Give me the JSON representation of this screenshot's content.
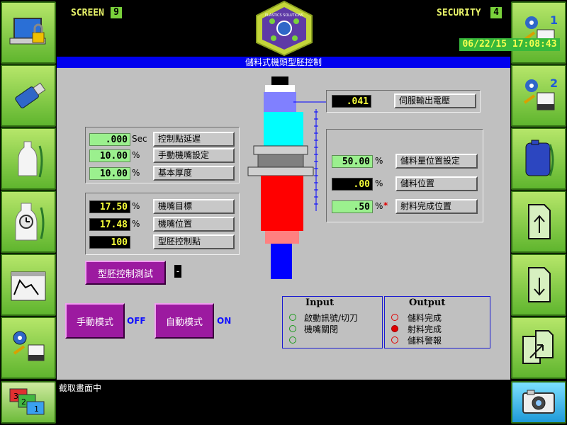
{
  "header": {
    "screen_label": "SCREEN",
    "screen_number": "9",
    "security_label": "SECURITY",
    "security_level": "4",
    "datetime": "06/22/15 17:08:43",
    "logo_text": "PLASTICS SOLUTIONS"
  },
  "title": "儲料式機頭型胚控制",
  "left_panel_1": {
    "rows": [
      {
        "value": ".000",
        "unit": "Sec",
        "label": "控制點延遲"
      },
      {
        "value": "10.00",
        "unit": "%",
        "label": "手動機嘴設定"
      },
      {
        "value": "10.00",
        "unit": "%",
        "label": "基本厚度"
      }
    ]
  },
  "left_panel_2": {
    "rows": [
      {
        "value": "17.50",
        "unit": "%",
        "label": "機嘴目標"
      },
      {
        "value": "17.48",
        "unit": "%",
        "label": "機嘴位置"
      },
      {
        "value": "100",
        "unit": "",
        "label": "型胚控制點"
      }
    ]
  },
  "servo": {
    "value": ".041",
    "label": "伺服輸出電壓"
  },
  "right_panel": {
    "rows": [
      {
        "value": "50.00",
        "unit": "%",
        "label": "儲料量位置設定"
      },
      {
        "value": ".00",
        "unit": "%",
        "label": "儲料位置"
      },
      {
        "value": ".50",
        "unit": "%",
        "mark": "*",
        "label": "射料完成位置"
      }
    ]
  },
  "parison_test": {
    "label": "型胚控制測試",
    "indicator": "-"
  },
  "manual_mode": {
    "label": "手動模式",
    "state": "OFF"
  },
  "auto_mode": {
    "label": "自動模式",
    "state": "ON"
  },
  "input_box": {
    "title": "Input",
    "items": [
      "啟動訊號/切刀",
      "機嘴關閉",
      ""
    ]
  },
  "output_box": {
    "title": "Output",
    "items": [
      "儲料完成",
      "射料完成",
      "儲料警報"
    ]
  },
  "status_text": "截取畫面中",
  "colors": {
    "accent_green": "#7ad23b",
    "title_blue": "#0000ee",
    "panel_gray": "#c0c0c0",
    "button_magenta": "#9c1aa0",
    "led_active": "#e00000"
  },
  "icons": {
    "left_sidebar": [
      "laptop-lock-icon",
      "usb-drive-icon",
      "bottle-icon",
      "bottle-clock-icon",
      "chart-window-icon",
      "settings-machine-icon"
    ],
    "right_sidebar": [
      "setup-1-icon",
      "setup-2-icon",
      "container-icon",
      "upload-doc-icon",
      "download-doc-icon",
      "transfer-doc-icon"
    ],
    "bottom_left": "screens-stack-icon",
    "bottom_right": "camera-icon"
  }
}
